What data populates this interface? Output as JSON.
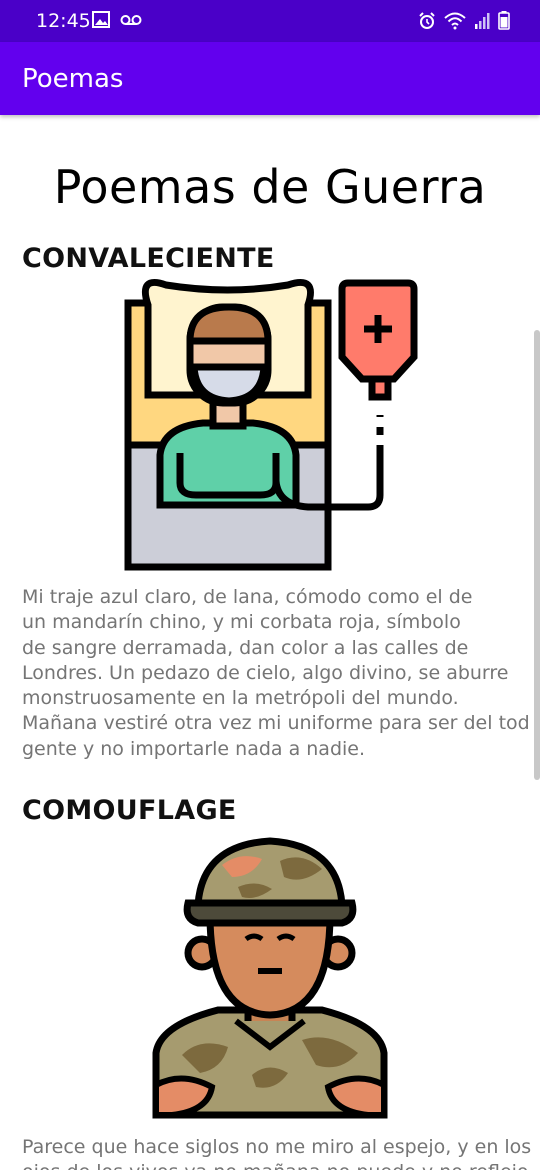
{
  "status_bar": {
    "time": "12:45",
    "left_icons": [
      "image-icon",
      "voicemail-icon"
    ],
    "right_icons": [
      "alarm-icon",
      "wifi-icon",
      "signal-icon",
      "battery-icon"
    ]
  },
  "app_bar": {
    "title": "Poemas"
  },
  "page": {
    "title": "Poemas de Guerra"
  },
  "poems": [
    {
      "title": "CONVALECIENTE",
      "illustration": "hospital-patient-icon",
      "text": "Mi traje azul claro, de lana, cómodo como el de\nun mandarín chino, y mi corbata roja, símbolo\nde sangre derramada, dan color a las calles de\nLondres. Un pedazo de cielo, algo divino, se aburre\nmonstruosamente en la metrópoli del mundo.\nMañana vestiré otra vez mi uniforme para ser del tod\ngente y no importarle nada a nadie."
    },
    {
      "title": "COMOUFLAGE",
      "illustration": "soldier-icon",
      "text": "Parece que hace siglos no me miro al espejo, y en los\nojos de los vivos ya no mañana no puede y no reflejo"
    }
  ]
}
